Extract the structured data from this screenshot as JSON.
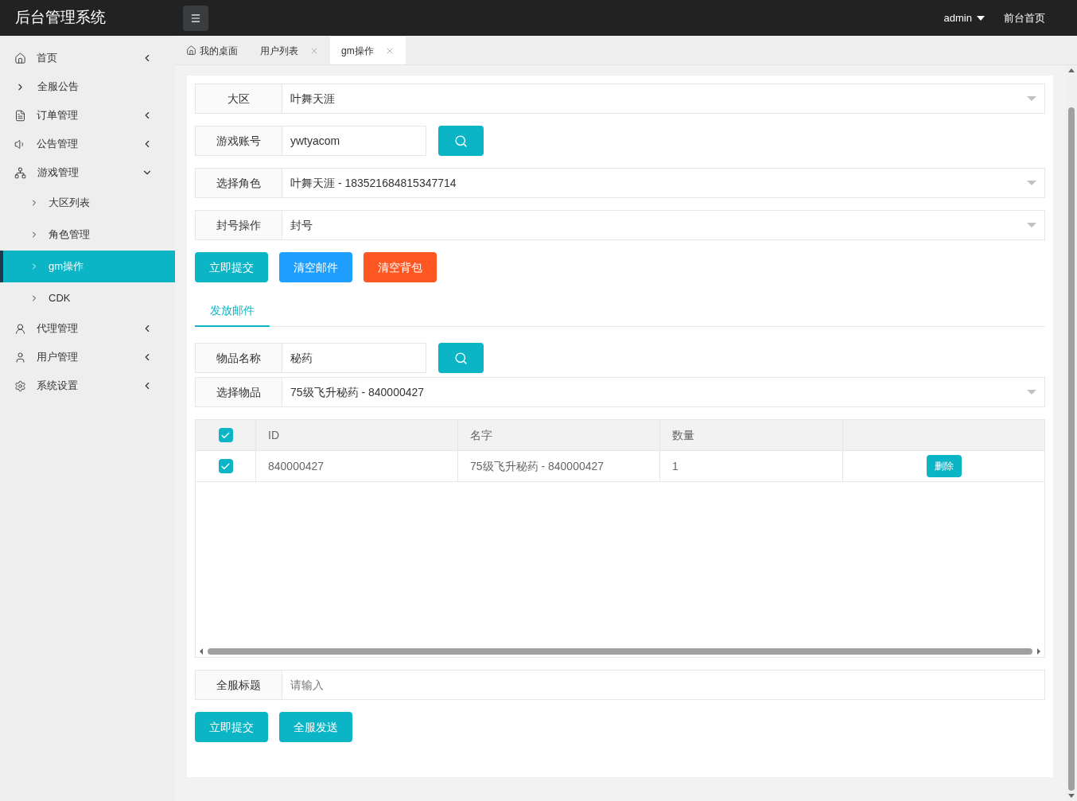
{
  "header": {
    "title": "后台管理系统",
    "user": "admin",
    "home_link": "前台首页"
  },
  "sidebar": {
    "items": [
      {
        "label": "首页",
        "kind": "group",
        "expanded": false,
        "selected": false
      },
      {
        "label": "全服公告",
        "kind": "link",
        "selected": false
      },
      {
        "label": "订单管理",
        "kind": "group",
        "expanded": false,
        "selected": false
      },
      {
        "label": "公告管理",
        "kind": "group",
        "expanded": false,
        "selected": false
      },
      {
        "label": "游戏管理",
        "kind": "group",
        "expanded": true,
        "selected": false,
        "children": [
          {
            "label": "大区列表",
            "selected": false
          },
          {
            "label": "角色管理",
            "selected": false
          },
          {
            "label": "gm操作",
            "selected": true
          },
          {
            "label": "CDK",
            "selected": false
          }
        ]
      },
      {
        "label": "代理管理",
        "kind": "group",
        "expanded": false,
        "selected": false
      },
      {
        "label": "用户管理",
        "kind": "group",
        "expanded": false,
        "selected": false
      },
      {
        "label": "系统设置",
        "kind": "group",
        "expanded": false,
        "selected": false
      }
    ]
  },
  "tabs": [
    {
      "label": "我的桌面",
      "kind": "home",
      "selected": false
    },
    {
      "label": "用户列表",
      "kind": "closable",
      "selected": false
    },
    {
      "label": "gm操作",
      "kind": "closable",
      "selected": true
    }
  ],
  "form": [
    {
      "label": "大区",
      "kind": "select",
      "value": "叶舞天涯"
    },
    {
      "label": "游戏账号",
      "kind": "search",
      "value": "ywtyacom"
    },
    {
      "label": "选择角色",
      "kind": "select",
      "value": "叶舞天涯 - 183521684815347714"
    },
    {
      "label": "封号操作",
      "kind": "select",
      "value": "封号"
    }
  ],
  "actions": [
    {
      "label": "立即提交",
      "color": "#0bb5c5"
    },
    {
      "label": "清空邮件",
      "color": "#1e9fff"
    },
    {
      "label": "清空背包",
      "color": "#ff5722"
    }
  ],
  "mail_tabs": [
    {
      "label": "发放邮件",
      "selected": true
    }
  ],
  "mail_form": [
    {
      "label": "物品名称",
      "kind": "search",
      "value": "秘药"
    },
    {
      "label": "选择物品",
      "kind": "select",
      "value": "75级飞升秘药 - 840000427"
    }
  ],
  "table": {
    "all_checked": true,
    "columns": [
      "ID",
      "名字",
      "数量"
    ],
    "rows": [
      {
        "checked": true,
        "cells": [
          "840000427",
          "75级飞升秘药 - 840000427",
          "1"
        ],
        "action": "删除"
      }
    ]
  },
  "broadcast": {
    "label": "全服标题",
    "placeholder": "请输入"
  },
  "bottom_actions": [
    {
      "label": "立即提交",
      "color": "#0bb5c5"
    },
    {
      "label": "全服发送",
      "color": "#0bb5c5"
    }
  ]
}
